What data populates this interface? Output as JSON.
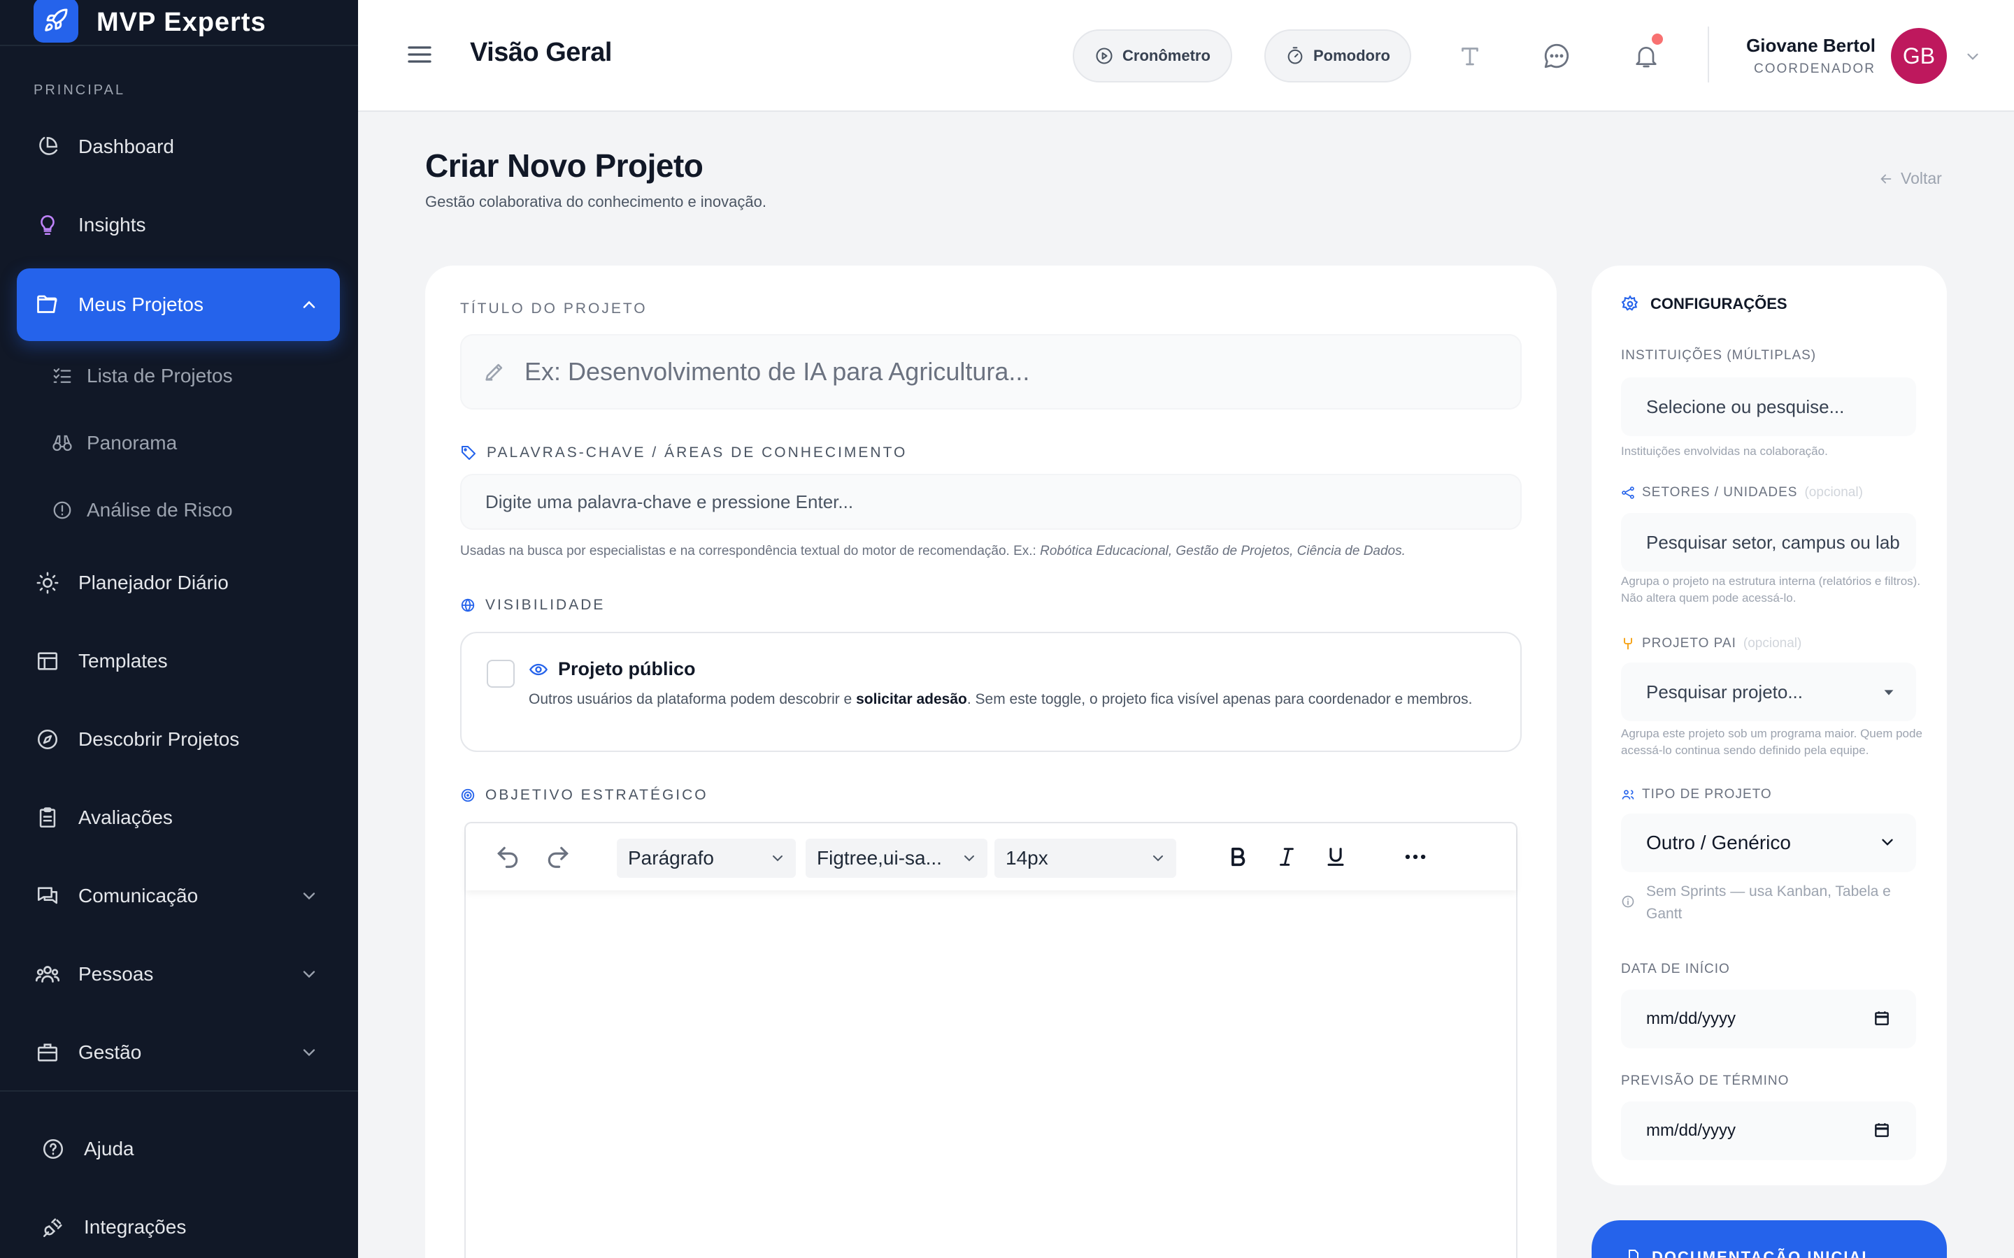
{
  "brand": {
    "name": "MVP Experts"
  },
  "sidebar": {
    "section_label": "PRINCIPAL",
    "items": [
      {
        "label": "Dashboard"
      },
      {
        "label": "Insights"
      },
      {
        "label": "Meus Projetos"
      },
      {
        "label": "Lista de Projetos"
      },
      {
        "label": "Panorama"
      },
      {
        "label": "Análise de Risco"
      },
      {
        "label": "Planejador Diário"
      },
      {
        "label": "Templates"
      },
      {
        "label": "Descobrir Projetos"
      },
      {
        "label": "Avaliações"
      },
      {
        "label": "Comunicação"
      },
      {
        "label": "Pessoas"
      },
      {
        "label": "Gestão"
      },
      {
        "label": "Ajuda"
      },
      {
        "label": "Integrações"
      }
    ]
  },
  "header": {
    "title": "Visão Geral",
    "cronometro": "Cronômetro",
    "pomodoro": "Pomodoro",
    "user_name": "Giovane Bertol",
    "user_role": "COORDENADOR",
    "avatar_initials": "GB"
  },
  "page": {
    "title": "Criar Novo Projeto",
    "subtitle": "Gestão colaborativa do conhecimento e inovação.",
    "back": "Voltar"
  },
  "form": {
    "title_label": "TÍTULO DO PROJETO",
    "title_placeholder": "Ex: Desenvolvimento de IA para Agricultura...",
    "keywords_label": "PALAVRAS-CHAVE / ÁREAS DE CONHECIMENTO",
    "keywords_placeholder": "Digite uma palavra-chave e pressione Enter...",
    "keywords_hint": "Usadas na busca por especialistas e na correspondência textual do motor de recomendação. Ex.:",
    "keywords_examples": "Robótica Educacional, Gestão de Projetos, Ciência de Dados.",
    "visibility_label": "VISIBILIDADE",
    "public_title": "Projeto público",
    "public_desc_1": "Outros usuários da plataforma podem descobrir e",
    "public_desc_bold": "solicitar adesão",
    "public_desc_2": ". Sem este toggle, o projeto fica visível apenas para coordenador e membros.",
    "objective_label": "OBJETIVO ESTRATÉGICO",
    "editor": {
      "block_format": "Parágrafo",
      "font_family": "Figtree,ui-sa...",
      "font_size": "14px"
    }
  },
  "config": {
    "heading": "CONFIGURAÇÕES",
    "institutions_label": "INSTITUIÇÕES (MÚLTIPLAS)",
    "institutions_placeholder": "Selecione ou pesquise...",
    "institutions_hint": "Instituições envolvidas na colaboração.",
    "sectors_label": "SETORES / UNIDADES",
    "optional": "(opcional)",
    "sectors_placeholder": "Pesquisar setor, campus ou lab",
    "sectors_hint": "Agrupa o projeto na estrutura interna (relatórios e filtros). Não altera quem pode acessá-lo.",
    "parent_label": "PROJETO PAI",
    "parent_placeholder": "Pesquisar projeto...",
    "parent_hint": "Agrupa este projeto sob um programa maior. Quem pode acessá-lo continua sendo definido pela equipe.",
    "type_label": "TIPO DE PROJETO",
    "type_value": "Outro / Genérico",
    "type_info": "Sem Sprints — usa Kanban, Tabela e Gantt",
    "start_label": "DATA DE INÍCIO",
    "start_value": "mm/dd/yyyy",
    "end_label": "PREVISÃO DE TÉRMINO",
    "end_value": "mm/dd/yyyy"
  },
  "doc_button": "DOCUMENTAÇÃO INICIAL",
  "colors": {
    "accent": "#2563eb",
    "sidebar_bg": "#111827",
    "avatar": "#be185d"
  }
}
